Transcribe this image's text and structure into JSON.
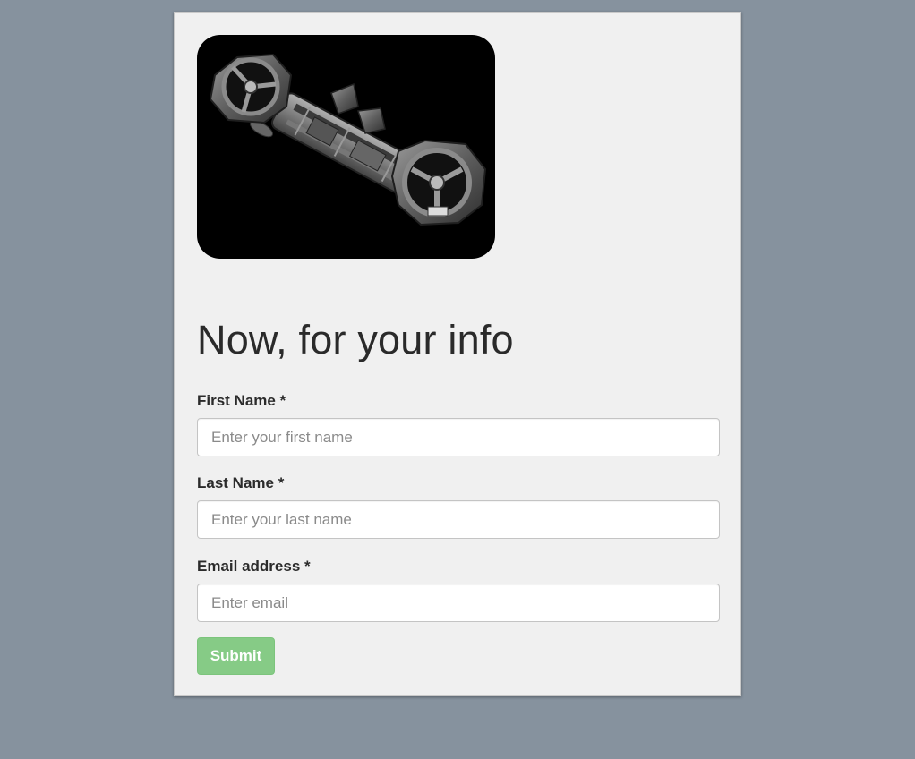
{
  "form": {
    "title": "Now, for your info",
    "fields": [
      {
        "label": "First Name *",
        "placeholder": "Enter your first name",
        "value": ""
      },
      {
        "label": "Last Name *",
        "placeholder": "Enter your last name",
        "value": ""
      },
      {
        "label": "Email address *",
        "placeholder": "Enter email",
        "value": ""
      }
    ],
    "submit_label": "Submit"
  },
  "colors": {
    "page_background": "#86929e",
    "card_background": "#f0f0f0",
    "submit_button": "#86cb86"
  },
  "hero_image": {
    "subject": "mechanical-spaceship"
  }
}
